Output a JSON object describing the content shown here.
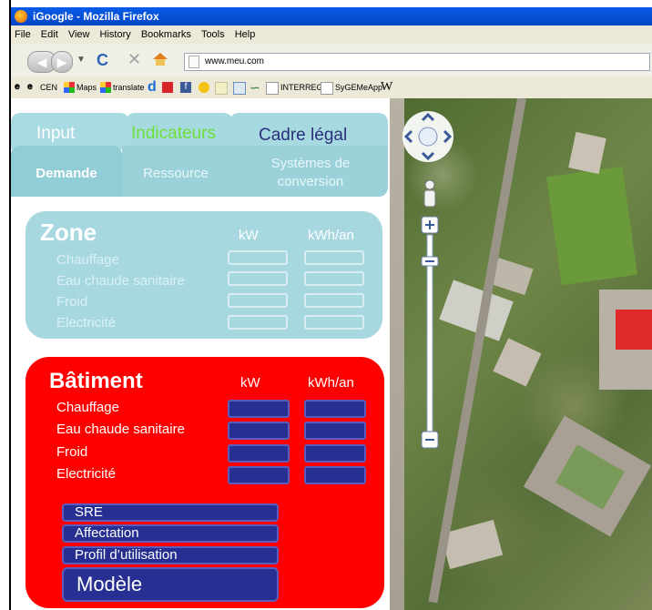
{
  "window": {
    "title": "iGoogle - Mozilla Firefox"
  },
  "menu": [
    "File",
    "Edit",
    "View",
    "History",
    "Bookmarks",
    "Tools",
    "Help"
  ],
  "nav": {
    "url": "www.meu.com"
  },
  "bookmarks": [
    {
      "label": "CEN",
      "icon": "epfl-logo-icon"
    },
    {
      "label": "Maps",
      "icon": "maps-icon"
    },
    {
      "label": "translate",
      "icon": "translate-icon"
    },
    {
      "label": "INTERREG",
      "icon": "page-icon"
    },
    {
      "label": "SyGEMeApp",
      "icon": "page-icon"
    }
  ],
  "tabs": {
    "input": "Input",
    "indicateurs": "Indicateurs",
    "cadre": "Cadre légal"
  },
  "subtabs": {
    "demande": "Demande",
    "ressource": "Ressource",
    "systemes": "Systèmes de conversion"
  },
  "zone": {
    "title": "Zone",
    "col_kw": "kW",
    "col_kwh": "kWh/an",
    "rows": [
      "Chauffage",
      "Eau chaude sanitaire",
      "Froid",
      "Electricité"
    ]
  },
  "batiment": {
    "title": "Bâtiment",
    "col_kw": "kW",
    "col_kwh": "kWh/an",
    "rows": [
      "Chauffage",
      "Eau chaude sanitaire",
      "Froid",
      "Electricité"
    ],
    "buttons": {
      "sre": "SRE",
      "affectation": "Affectation",
      "profil": "Profil d’utilisation",
      "modele": "Modèle"
    }
  },
  "colors": {
    "accent_red": "#fe0000",
    "zone_bg": "#a7d8e0",
    "button_blue": "#273092",
    "tab_green": "#6fe03a",
    "tab_navy": "#2a2f7a"
  }
}
